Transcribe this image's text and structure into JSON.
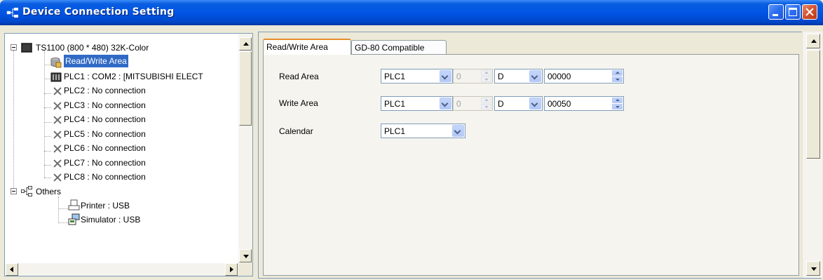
{
  "window": {
    "title": "Device Connection Setting",
    "icon": "network-tree-icon"
  },
  "tree": {
    "root": {
      "label": "TS1100 (800 * 480) 32K-Color",
      "icon": "monitor-icon"
    },
    "items": [
      {
        "label": "Read/Write Area",
        "icon": "database-icon",
        "selected": true
      },
      {
        "label": "PLC1 : COM2 : [MITSUBISHI ELECT",
        "icon": "plc-icon"
      },
      {
        "label": "PLC2 : No connection",
        "icon": "x-icon"
      },
      {
        "label": "PLC3 : No connection",
        "icon": "x-icon"
      },
      {
        "label": "PLC4 : No connection",
        "icon": "x-icon"
      },
      {
        "label": "PLC5 : No connection",
        "icon": "x-icon"
      },
      {
        "label": "PLC6 : No connection",
        "icon": "x-icon"
      },
      {
        "label": "PLC7 : No connection",
        "icon": "x-icon"
      },
      {
        "label": "PLC8 : No connection",
        "icon": "x-icon"
      }
    ],
    "others": {
      "label": "Others",
      "icon": "network-icon",
      "children": [
        {
          "label": "Printer : USB",
          "icon": "printer-icon"
        },
        {
          "label": "Simulator : USB",
          "icon": "simulator-icon"
        }
      ]
    }
  },
  "tabs": [
    {
      "label": "Read/Write Area",
      "active": true
    },
    {
      "label": "GD-80 Compatible",
      "active": false
    }
  ],
  "form": {
    "read_area": {
      "label": "Read Area",
      "plc": "PLC1",
      "port": "0",
      "device": "D",
      "address": "00000"
    },
    "write_area": {
      "label": "Write Area",
      "plc": "PLC1",
      "port": "0",
      "device": "D",
      "address": "00050"
    },
    "calendar": {
      "label": "Calendar",
      "plc": "PLC1"
    }
  },
  "colors": {
    "titlebar": "#0055e5",
    "selection": "#316ac5",
    "active_tab_accent": "#e68b2c"
  }
}
